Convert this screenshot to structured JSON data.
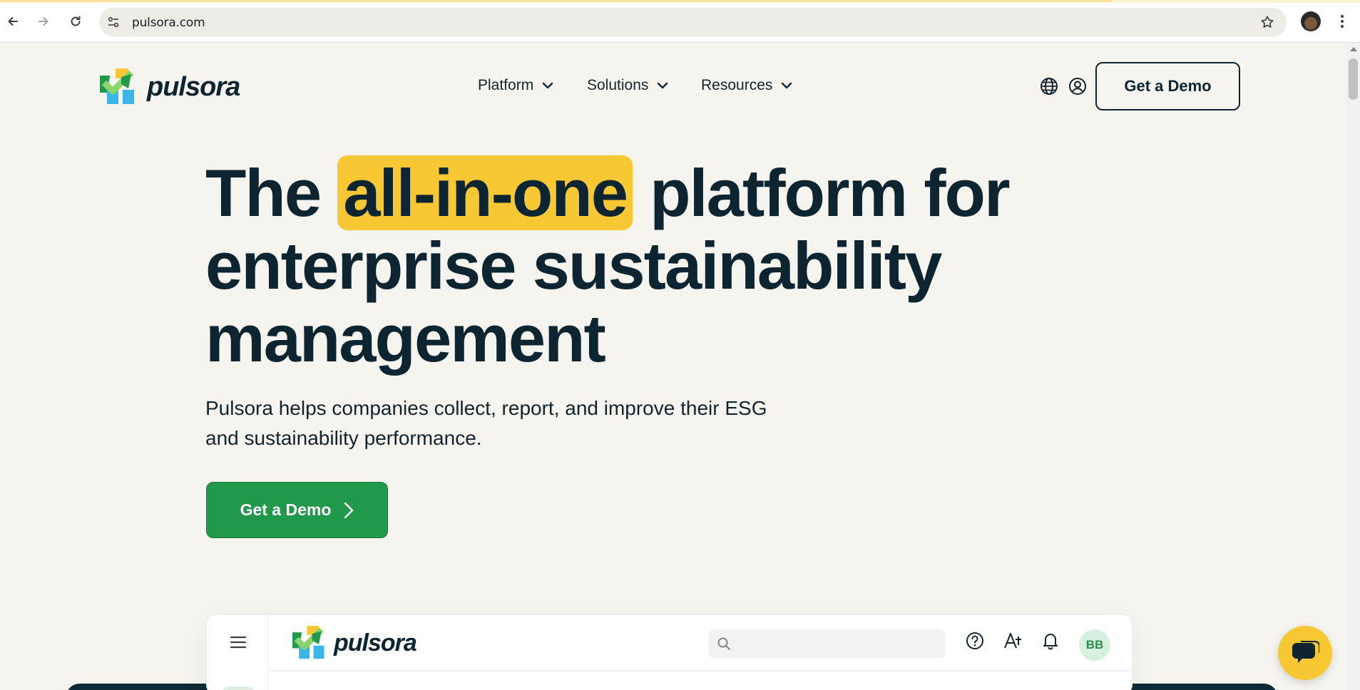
{
  "browser": {
    "url": "pulsora.com",
    "icons": {
      "back": "back-arrow-icon",
      "forward": "forward-arrow-icon",
      "reload": "reload-icon",
      "site_info": "tune-icon",
      "bookmark": "star-icon",
      "menu": "kebab-menu-icon"
    }
  },
  "header": {
    "logo_text": "pulsora",
    "nav": [
      {
        "label": "Platform"
      },
      {
        "label": "Solutions"
      },
      {
        "label": "Resources"
      }
    ],
    "cta_label": "Get a Demo"
  },
  "hero": {
    "title_pre": "The ",
    "title_highlight": "all-in-one",
    "title_line1_post": " platform for",
    "title_line2": "enterprise sustainability",
    "title_line3": "management",
    "subtitle_line1": "Pulsora helps companies collect, report, and improve their ESG",
    "subtitle_line2": "and sustainability performance.",
    "cta_label": "Get a Demo"
  },
  "preview": {
    "logo_text": "pulsora",
    "avatar_initials": "BB"
  },
  "colors": {
    "brand_yellow": "#f7c833",
    "brand_green": "#22994a",
    "ink": "#0d2530",
    "page_bg": "#f6f4ef"
  }
}
